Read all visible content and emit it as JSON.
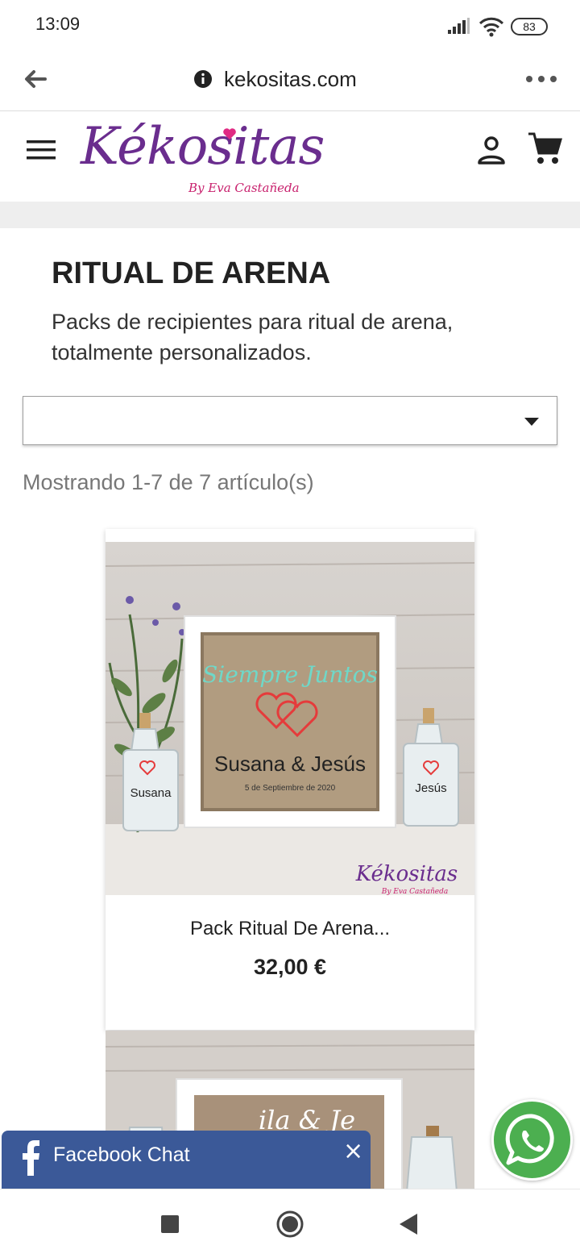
{
  "status_bar": {
    "time": "13:09",
    "battery": "83",
    "icons": [
      "signal-icon",
      "wifi-icon",
      "battery-icon"
    ]
  },
  "browser": {
    "url": "kekositas.com",
    "icons": [
      "back-arrow-icon",
      "info-icon",
      "more-options-icon"
    ]
  },
  "header": {
    "logo_main": "Kékositas",
    "logo_sub": "By Eva Castañeda",
    "icons": [
      "hamburger-menu-icon",
      "user-icon",
      "cart-icon"
    ],
    "brand_color": "#6a2d8e",
    "accent_color": "#c8206d"
  },
  "category": {
    "title": "RITUAL DE ARENA",
    "description": "Packs de recipientes para ritual de arena, totalmente personalizados."
  },
  "sort": {
    "selected": ""
  },
  "results": {
    "count_text": "Mostrando 1-7 de 7 artículo(s)"
  },
  "products": [
    {
      "name": "Pack Ritual De Arena...",
      "price": "32,00 €",
      "image_text": {
        "headline": "Siempre Juntos",
        "names": "Susana & Jesús",
        "date": "5 de Septiembre de 2020",
        "bottle_left": "Susana",
        "bottle_right": "Jesús",
        "watermark": "Kékositas",
        "watermark_sub": "By Eva Castañeda"
      }
    },
    {
      "image_text": {
        "names_partial": "ila & Je"
      }
    }
  ],
  "facebook_chat": {
    "label": "Facebook Chat",
    "close": "×",
    "color": "#3b5998"
  },
  "whatsapp": {
    "icon": "whatsapp-icon",
    "color": "#4caf50"
  },
  "nav_bar": {
    "icons": [
      "recent-apps-icon",
      "home-icon",
      "back-icon"
    ]
  }
}
